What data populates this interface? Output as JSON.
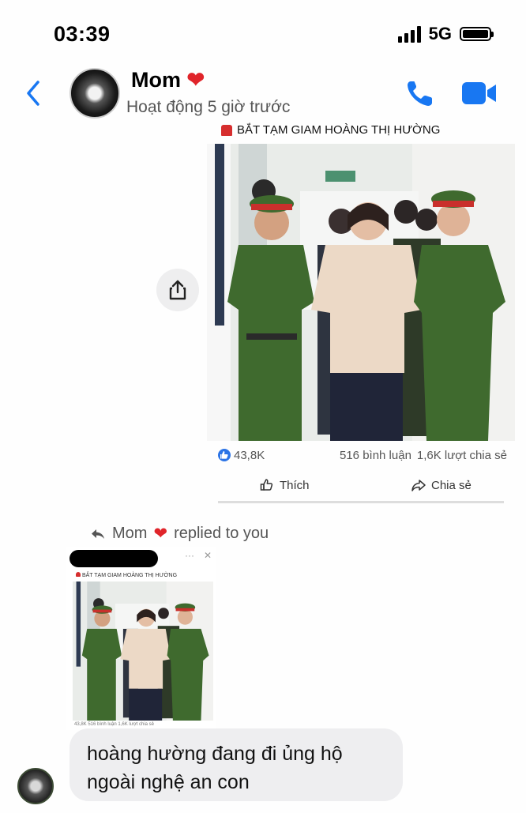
{
  "status_bar": {
    "time": "03:39",
    "network": "5G",
    "battery_level": 1.0
  },
  "header": {
    "contact_name": "Mom",
    "heart": "❤",
    "activity_status": "Hoạt động 5 giờ trước",
    "icons": [
      "chevron-left-icon",
      "phone-icon",
      "video-camera-icon"
    ],
    "accent_color": "#1877f2"
  },
  "shared_post": {
    "title": "BẮT TẠM GIAM HOÀNG THỊ HƯỜNG",
    "likes": "43,8K",
    "comments": "516 bình luận",
    "shares": "1,6K lượt chia sẻ",
    "like_label": "Thích",
    "share_label": "Chia sẻ"
  },
  "reply": {
    "sender": "Mom",
    "heart": "❤",
    "label": "replied to you",
    "quoted_title": "BẮT TẠM GIAM HOÀNG THỊ HƯỜNG",
    "quoted_stats": "43,8K    516 bình luận   1,6K lượt chia sẻ"
  },
  "message": {
    "text": "hoàng hường đang đi ủng hộ ngoài nghệ an con"
  }
}
